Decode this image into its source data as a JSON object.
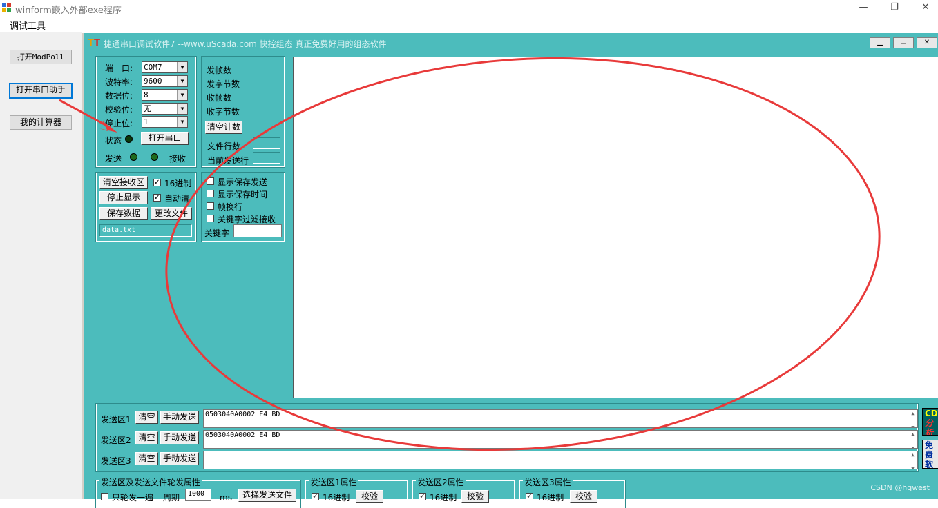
{
  "window": {
    "title": "winform嵌入外部exe程序",
    "minimize": "—",
    "maximize": "❐",
    "close": "✕"
  },
  "menu": {
    "debug_tools": "调试工具"
  },
  "left_buttons": {
    "modpoll": "打开ModPoll",
    "serial_helper": "打开串口助手",
    "calculator": "我的计算器"
  },
  "app": {
    "title": "捷通串口调试软件7   --www.uScada.com   快控组态   真正免费好用的组态软件",
    "port": {
      "label": "端　口:",
      "value": "COM7"
    },
    "baud": {
      "label": "波特率:",
      "value": "9600"
    },
    "databits": {
      "label": "数据位:",
      "value": "8"
    },
    "parity": {
      "label": "校验位:",
      "value": "无"
    },
    "stopbits": {
      "label": "停止位:",
      "value": "1"
    },
    "status_label": "状态",
    "open_port": "打开串口",
    "send_label": "发送",
    "recv_label": "接收",
    "counters": {
      "send_frames": "发帧数",
      "send_bytes": "发字节数",
      "recv_frames": "收帧数",
      "recv_bytes": "收字节数",
      "clear_count": "清空计数",
      "file_lines": "文件行数",
      "current_line": "当前发送行"
    },
    "recv_ctrl": {
      "clear_recv": "清空接收区",
      "hex": "16进制",
      "stop_display": "停止显示",
      "auto_clear": "自动清",
      "save_data": "保存数据",
      "change_file": "更改文件",
      "filename": "data.txt"
    },
    "options": {
      "show_save_send": "显示保存发送",
      "show_save_time": "显示保存时间",
      "frame_newline": "帧换行",
      "keyword_filter": "关键字过滤接收",
      "keyword_label": "关键字"
    },
    "send": {
      "clear": "清空",
      "manual_send": "手动发送",
      "zones": [
        {
          "label": "发送区1",
          "value": "0503040A0002 E4 BD"
        },
        {
          "label": "发送区2",
          "value": "0503040A0002 E4 BD"
        },
        {
          "label": "发送区3",
          "value": ""
        }
      ]
    },
    "bottom": {
      "rotate_title": "发送区及发送文件轮发属性",
      "only_once": "只轮发一遍",
      "period_label": "周期",
      "period_value": "1000",
      "ms": "ms",
      "select_file": "选择发送文件",
      "zone1_props": "发送区1属性",
      "zone2_props": "发送区2属性",
      "zone3_props": "发送区3属性",
      "hex": "16进制",
      "verify": "校验"
    },
    "ads": {
      "ad1_line1": "CDT",
      "ad1_line2": "分析",
      "ad2_line1": "免费",
      "ad2_line2": "软件"
    },
    "watermark": "CSDN @hqwest"
  }
}
